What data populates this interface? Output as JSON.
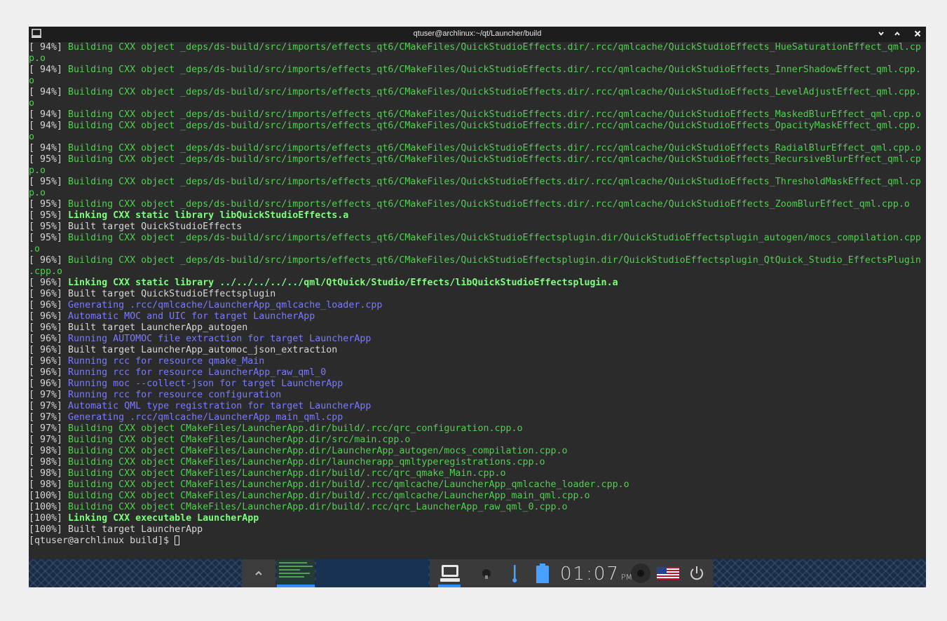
{
  "window": {
    "title": "qtuser@archlinux:~/qt/Launcher/build",
    "icons": {
      "app": "terminal-icon",
      "minimize": "chevron-down-icon",
      "maximize": "chevron-up-icon",
      "close": "close-icon"
    }
  },
  "terminal": {
    "lines": [
      {
        "pct": "[ 94%]",
        "text": "Building CXX object _deps/ds-build/src/imports/effects_qt6/CMakeFiles/QuickStudioEffects.dir/.rcc/qmlcache/QuickStudioEffects_HueSaturationEffect_qml.cp",
        "style": "green"
      },
      {
        "pct": "",
        "text": "p.o",
        "style": "green"
      },
      {
        "pct": "[ 94%]",
        "text": "Building CXX object _deps/ds-build/src/imports/effects_qt6/CMakeFiles/QuickStudioEffects.dir/.rcc/qmlcache/QuickStudioEffects_InnerShadowEffect_qml.cpp.",
        "style": "green"
      },
      {
        "pct": "",
        "text": "o",
        "style": "green"
      },
      {
        "pct": "[ 94%]",
        "text": "Building CXX object _deps/ds-build/src/imports/effects_qt6/CMakeFiles/QuickStudioEffects.dir/.rcc/qmlcache/QuickStudioEffects_LevelAdjustEffect_qml.cpp.",
        "style": "green"
      },
      {
        "pct": "",
        "text": "o",
        "style": "green"
      },
      {
        "pct": "[ 94%]",
        "text": "Building CXX object _deps/ds-build/src/imports/effects_qt6/CMakeFiles/QuickStudioEffects.dir/.rcc/qmlcache/QuickStudioEffects_MaskedBlurEffect_qml.cpp.o",
        "style": "green"
      },
      {
        "pct": "[ 94%]",
        "text": "Building CXX object _deps/ds-build/src/imports/effects_qt6/CMakeFiles/QuickStudioEffects.dir/.rcc/qmlcache/QuickStudioEffects_OpacityMaskEffect_qml.cpp.",
        "style": "green"
      },
      {
        "pct": "",
        "text": "o",
        "style": "green"
      },
      {
        "pct": "[ 94%]",
        "text": "Building CXX object _deps/ds-build/src/imports/effects_qt6/CMakeFiles/QuickStudioEffects.dir/.rcc/qmlcache/QuickStudioEffects_RadialBlurEffect_qml.cpp.o",
        "style": "green"
      },
      {
        "pct": "[ 95%]",
        "text": "Building CXX object _deps/ds-build/src/imports/effects_qt6/CMakeFiles/QuickStudioEffects.dir/.rcc/qmlcache/QuickStudioEffects_RecursiveBlurEffect_qml.cp",
        "style": "green"
      },
      {
        "pct": "",
        "text": "p.o",
        "style": "green"
      },
      {
        "pct": "[ 95%]",
        "text": "Building CXX object _deps/ds-build/src/imports/effects_qt6/CMakeFiles/QuickStudioEffects.dir/.rcc/qmlcache/QuickStudioEffects_ThresholdMaskEffect_qml.cp",
        "style": "green"
      },
      {
        "pct": "",
        "text": "p.o",
        "style": "green"
      },
      {
        "pct": "[ 95%]",
        "text": "Building CXX object _deps/ds-build/src/imports/effects_qt6/CMakeFiles/QuickStudioEffects.dir/.rcc/qmlcache/QuickStudioEffects_ZoomBlurEffect_qml.cpp.o",
        "style": "green"
      },
      {
        "pct": "[ 95%]",
        "text": "Linking CXX static library libQuickStudioEffects.a",
        "style": "bgreen"
      },
      {
        "pct": "[ 95%]",
        "text": "Built target QuickStudioEffects",
        "style": "white"
      },
      {
        "pct": "[ 95%]",
        "text": "Building CXX object _deps/ds-build/src/imports/effects_qt6/CMakeFiles/QuickStudioEffectsplugin.dir/QuickStudioEffectsplugin_autogen/mocs_compilation.cpp",
        "style": "green"
      },
      {
        "pct": "",
        "text": ".o",
        "style": "green"
      },
      {
        "pct": "[ 96%]",
        "text": "Building CXX object _deps/ds-build/src/imports/effects_qt6/CMakeFiles/QuickStudioEffectsplugin.dir/QuickStudioEffectsplugin_QtQuick_Studio_EffectsPlugin",
        "style": "green"
      },
      {
        "pct": "",
        "text": ".cpp.o",
        "style": "green"
      },
      {
        "pct": "[ 96%]",
        "text": "Linking CXX static library ../../../../../qml/QtQuick/Studio/Effects/libQuickStudioEffectsplugin.a",
        "style": "bgreen"
      },
      {
        "pct": "[ 96%]",
        "text": "Built target QuickStudioEffectsplugin",
        "style": "white"
      },
      {
        "pct": "[ 96%]",
        "text": "Generating .rcc/qmlcache/LauncherApp_qmlcache_loader.cpp",
        "style": "blue"
      },
      {
        "pct": "[ 96%]",
        "text": "Automatic MOC and UIC for target LauncherApp",
        "style": "blue"
      },
      {
        "pct": "[ 96%]",
        "text": "Built target LauncherApp_autogen",
        "style": "white"
      },
      {
        "pct": "[ 96%]",
        "text": "Running AUTOMOC file extraction for target LauncherApp",
        "style": "blue"
      },
      {
        "pct": "[ 96%]",
        "text": "Built target LauncherApp_automoc_json_extraction",
        "style": "white"
      },
      {
        "pct": "[ 96%]",
        "text": "Running rcc for resource qmake_Main",
        "style": "blue"
      },
      {
        "pct": "[ 96%]",
        "text": "Running rcc for resource LauncherApp_raw_qml_0",
        "style": "blue"
      },
      {
        "pct": "[ 96%]",
        "text": "Running moc --collect-json for target LauncherApp",
        "style": "blue"
      },
      {
        "pct": "[ 97%]",
        "text": "Running rcc for resource configuration",
        "style": "blue"
      },
      {
        "pct": "[ 97%]",
        "text": "Automatic QML type registration for target LauncherApp",
        "style": "blue"
      },
      {
        "pct": "[ 97%]",
        "text": "Generating .rcc/qmlcache/LauncherApp_main_qml.cpp",
        "style": "blue"
      },
      {
        "pct": "[ 97%]",
        "text": "Building CXX object CMakeFiles/LauncherApp.dir/build/.rcc/qrc_configuration.cpp.o",
        "style": "green"
      },
      {
        "pct": "[ 97%]",
        "text": "Building CXX object CMakeFiles/LauncherApp.dir/src/main.cpp.o",
        "style": "green"
      },
      {
        "pct": "[ 98%]",
        "text": "Building CXX object CMakeFiles/LauncherApp.dir/LauncherApp_autogen/mocs_compilation.cpp.o",
        "style": "green"
      },
      {
        "pct": "[ 98%]",
        "text": "Building CXX object CMakeFiles/LauncherApp.dir/launcherapp_qmltyperegistrations.cpp.o",
        "style": "green"
      },
      {
        "pct": "[ 98%]",
        "text": "Building CXX object CMakeFiles/LauncherApp.dir/build/.rcc/qrc_qmake_Main.cpp.o",
        "style": "green"
      },
      {
        "pct": "[ 98%]",
        "text": "Building CXX object CMakeFiles/LauncherApp.dir/build/.rcc/qmlcache/LauncherApp_qmlcache_loader.cpp.o",
        "style": "green"
      },
      {
        "pct": "[100%]",
        "text": "Building CXX object CMakeFiles/LauncherApp.dir/build/.rcc/qmlcache/LauncherApp_main_qml.cpp.o",
        "style": "green"
      },
      {
        "pct": "[100%]",
        "text": "Building CXX object CMakeFiles/LauncherApp.dir/build/.rcc/qrc_LauncherApp_raw_qml_0.cpp.o",
        "style": "green"
      },
      {
        "pct": "[100%]",
        "text": "Linking CXX executable LauncherApp",
        "style": "bgreen"
      },
      {
        "pct": "[100%]",
        "text": "Built target LauncherApp",
        "style": "white"
      }
    ],
    "prompt": "[qtuser@archlinux build]$ "
  },
  "taskbar": {
    "clock": {
      "time": "01:07",
      "ampm": "PM"
    },
    "icons": [
      "chevron-up-icon",
      "terminal-icon",
      "lightbulb-icon",
      "thermometer-icon",
      "battery-icon",
      "volume-knob-icon",
      "us-flag-icon",
      "power-icon"
    ],
    "colors": {
      "accent": "#2f8fff",
      "green": "#4fd04f",
      "blue": "#7a7aff"
    }
  }
}
